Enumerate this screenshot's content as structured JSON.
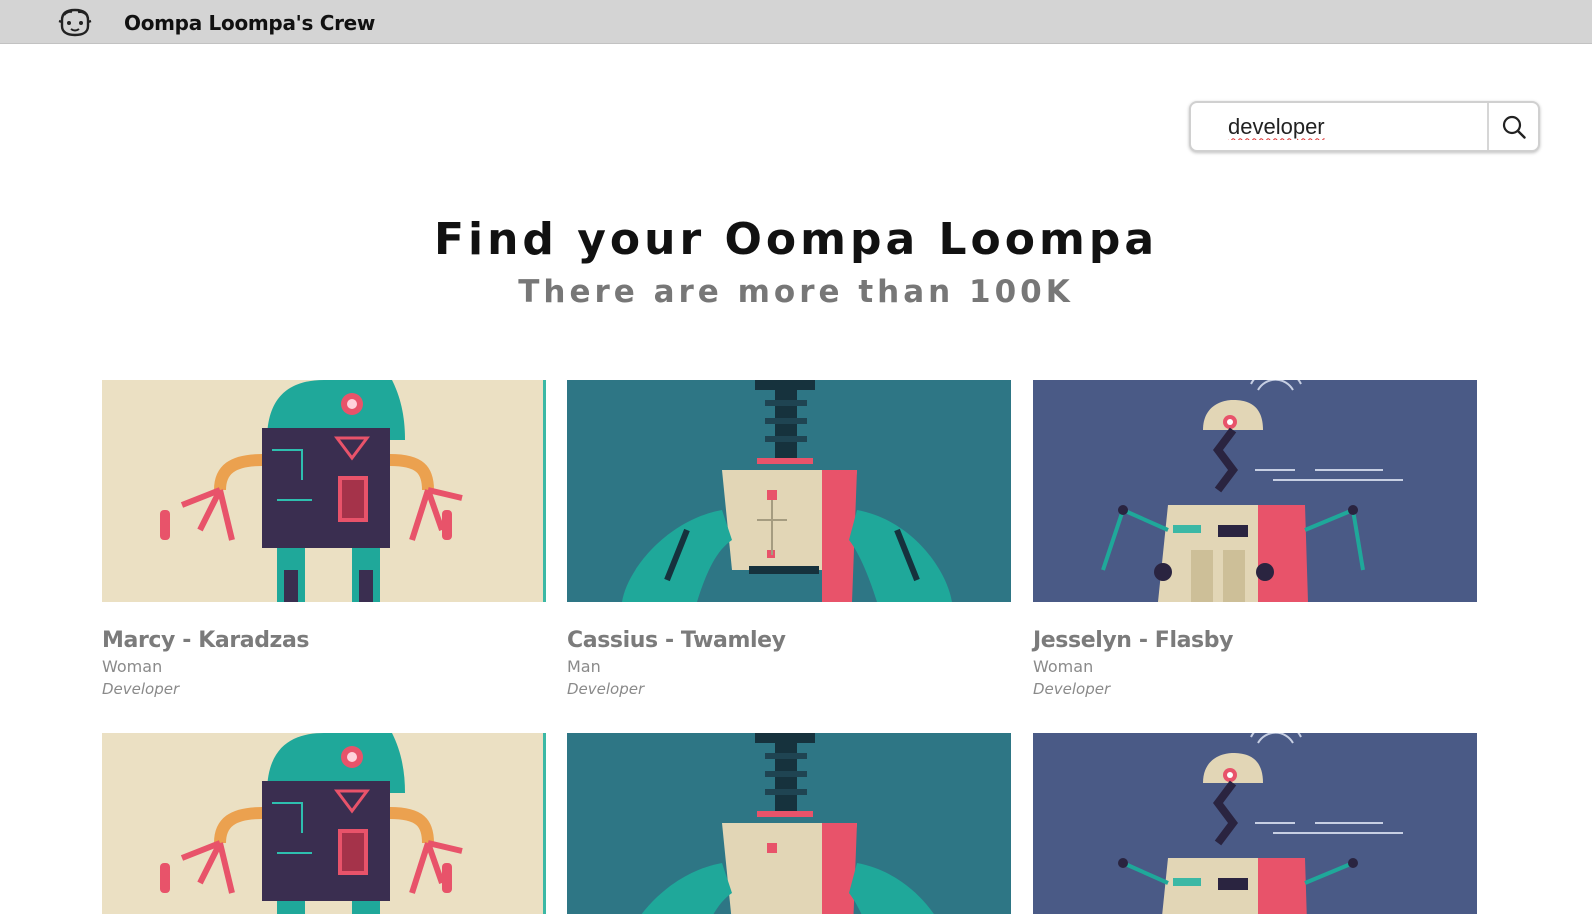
{
  "header": {
    "title": "Oompa Loompa's Crew",
    "logo_icon": "oompa-face-icon",
    "background": "#d4d4d4"
  },
  "search": {
    "value": "developer",
    "placeholder": "",
    "button_icon": "search-icon"
  },
  "hero": {
    "title": "Find your Oompa Loompa",
    "subtitle": "There are more than 100K"
  },
  "cards": [
    {
      "name": "Marcy - Karadzas",
      "gender": "Woman",
      "profession": "Developer",
      "image_theme": "robot-cream"
    },
    {
      "name": "Cassius - Twamley",
      "gender": "Man",
      "profession": "Developer",
      "image_theme": "robot-teal"
    },
    {
      "name": "Jesselyn - Flasby",
      "gender": "Woman",
      "profession": "Developer",
      "image_theme": "robot-blue"
    },
    {
      "name": "",
      "gender": "",
      "profession": "",
      "image_theme": "robot-cream"
    },
    {
      "name": "",
      "gender": "",
      "profession": "",
      "image_theme": "robot-teal"
    },
    {
      "name": "",
      "gender": "",
      "profession": "",
      "image_theme": "robot-blue"
    }
  ],
  "colors": {
    "cream_bg": "#ebe0c3",
    "teal_bg": "#2e7685",
    "blue_bg": "#4a5a86",
    "muted_text": "#7b7b7b"
  }
}
